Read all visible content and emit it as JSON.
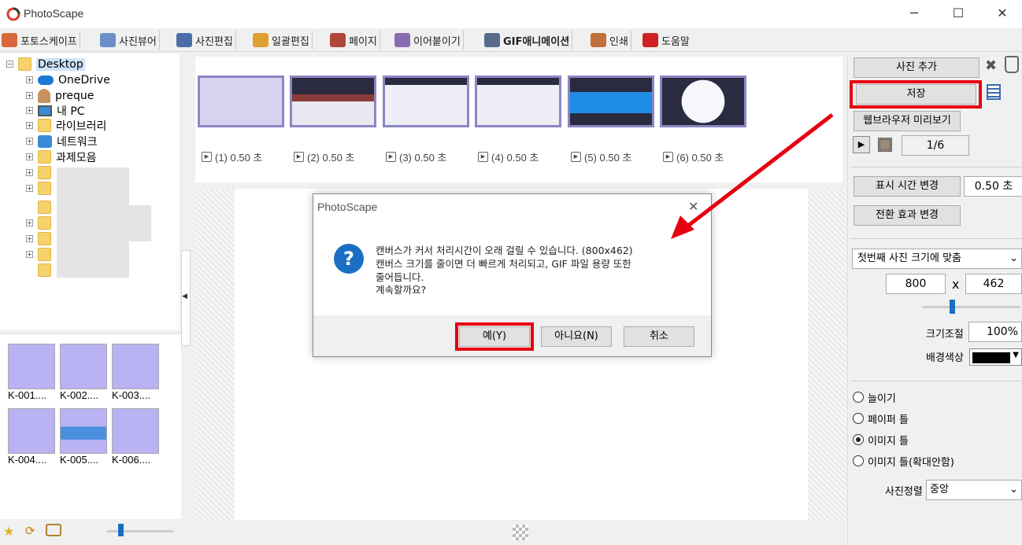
{
  "window": {
    "title": "PhotoScape",
    "minimize": "─",
    "maximize": "☐",
    "close": "✕"
  },
  "menu": {
    "tabs": [
      {
        "label": "포토스케이프",
        "color": "#d8683a"
      },
      {
        "label": "사진뷰어",
        "color": "#6b8fc9"
      },
      {
        "label": "사진편집",
        "color": "#4a6fa8"
      },
      {
        "label": "일괄편집",
        "color": "#e0a030"
      },
      {
        "label": "페이지",
        "color": "#b0463a"
      },
      {
        "label": "이어붙이기",
        "color": "#8a6ab0"
      },
      {
        "label": "GIF애니메이션",
        "color": "#5a6a8a"
      },
      {
        "label": "인쇄",
        "color": "#c0703a"
      },
      {
        "label": "도움말",
        "color": "#d02020"
      }
    ]
  },
  "tree": {
    "root": "Desktop",
    "items": [
      "OneDrive",
      "preque",
      "내 PC",
      "라이브러리",
      "네트워크",
      "과제모음"
    ]
  },
  "files": [
    {
      "name": "K-001...."
    },
    {
      "name": "K-002...."
    },
    {
      "name": "K-003...."
    },
    {
      "name": "K-004...."
    },
    {
      "name": "K-005...."
    },
    {
      "name": "K-006...."
    }
  ],
  "frames": [
    {
      "label": "(1) 0.50 초"
    },
    {
      "label": "(2) 0.50 초"
    },
    {
      "label": "(3) 0.50 초"
    },
    {
      "label": "(4) 0.50 초"
    },
    {
      "label": "(5) 0.50 초"
    },
    {
      "label": "(6) 0.50 초"
    }
  ],
  "right": {
    "add_photo": "사진 추가",
    "save": "저장",
    "browser_preview": "웹브라우저 미리보기",
    "frame_counter": "1/6",
    "change_time": "표시 시간 변경",
    "time_value": "0.50 초",
    "change_effect": "전환 효과 변경",
    "size_mode": "첫번째 사진 크기에 맞춤",
    "width": "800",
    "x_sep": "x",
    "height": "462",
    "scale_label": "크기조절",
    "scale_value": "100%",
    "bg_label": "배경색상",
    "bg_color": "#000000",
    "radios": [
      {
        "label": "늘이기",
        "checked": false
      },
      {
        "label": "페이퍼 틀",
        "checked": false
      },
      {
        "label": "이미지 틀",
        "checked": true
      },
      {
        "label": "이미지 틀(확대안함)",
        "checked": false
      }
    ],
    "align_label": "사진정렬",
    "align_value": "중앙"
  },
  "dialog": {
    "title": "PhotoScape",
    "icon": "?",
    "lines": [
      "캔버스가 커서 처리시간이 오래 걸릴 수 있습니다. (800x462)",
      "캔버스 크기를 줄이면 더 빠르게 처리되고, GIF 파일 용량 또한",
      "줄어듭니다.",
      "계속할까요?"
    ],
    "yes": "예(Y)",
    "no": "아니요(N)",
    "cancel": "취소"
  },
  "annotation_color": "#e60012"
}
